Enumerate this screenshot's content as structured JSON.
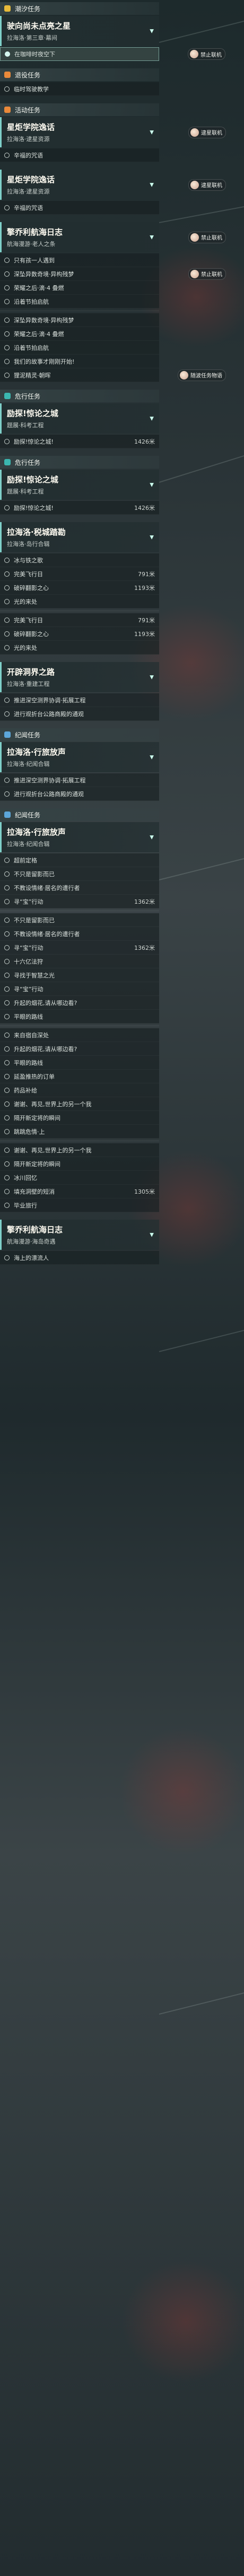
{
  "sections": [
    {
      "header": "潮汐任务",
      "headerIcon": "yellow",
      "card": {
        "title": "驶向尚未点亮之星",
        "subtitle": "拉海洛·第三章·幕间"
      },
      "rows": [
        {
          "label": "在咖啡时夜空下",
          "active": true,
          "tag": "禁止联机"
        }
      ]
    },
    {
      "header": "退役任务",
      "headerIcon": "orange",
      "rows": [
        {
          "label": "临时驾驶教学"
        }
      ]
    },
    {
      "header": "活动任务",
      "headerIcon": "orange",
      "card": {
        "title": "星炬学院逸话",
        "subtitle": "拉海洛·逮星资源",
        "tag": "逮星联机"
      },
      "rows": [
        {
          "label": "辛福的咒语"
        }
      ]
    },
    {
      "header": "",
      "card": {
        "title": "星炬学院逸话",
        "subtitle": "拉海洛·逮星资源",
        "tag": "逮星联机"
      },
      "rows": [
        {
          "label": "辛福的咒语"
        }
      ]
    },
    {
      "header": "",
      "card": {
        "title": "擎乔利航海日志",
        "subtitle": "航海漫游·老人之条",
        "tag": "禁止联机"
      },
      "rows": [
        {
          "label": "只有孩一人遇到"
        },
        {
          "label": "深坠异数奇境·异构残梦",
          "tag": "禁止联机"
        },
        {
          "label": "荣耀之后·滴·4 叠燃"
        },
        {
          "label": "沿着节拍启航"
        },
        {
          "label": ""
        },
        {
          "label": "深坠异数奇境·异构残梦"
        },
        {
          "label": "荣耀之后·滴·4 叠燃"
        },
        {
          "label": "沿着节拍启航"
        },
        {
          "label": "我们的故事才刚刚开始!"
        },
        {
          "label": "狸泥精灵·朝晖",
          "tag": "随波任务物语"
        }
      ]
    },
    {
      "header": "危行任务",
      "headerIcon": "teal",
      "card": {
        "title": "励探!惊论之城",
        "subtitle": "题展·科考工程"
      },
      "rows": [
        {
          "label": "励探!惊论之城!",
          "dist": "1426米"
        }
      ]
    },
    {
      "header": "危行任务",
      "headerIcon": "teal",
      "card": {
        "title": "励探!惊论之城",
        "subtitle": "题展·科考工程"
      },
      "rows": [
        {
          "label": "励探!惊论之城!",
          "dist": "1426米"
        }
      ]
    },
    {
      "header": "",
      "card": {
        "title": "拉海洛·税城踏勘",
        "subtitle": "拉海洛·岛行合辑"
      },
      "rows": [
        {
          "label": "冰与铁之歌"
        },
        {
          "label": "完美飞行日",
          "dist": "791米"
        },
        {
          "label": "破碎翻影之心",
          "dist": "1193米"
        },
        {
          "label": "光的来处"
        },
        {
          "label": ""
        },
        {
          "label": "完美飞行日",
          "dist": "791米"
        },
        {
          "label": "破碎翻影之心",
          "dist": "1193米"
        },
        {
          "label": "光的来处"
        }
      ]
    },
    {
      "header": "",
      "card": {
        "title": "开辟洞界之路",
        "subtitle": "拉海洛·重建工程"
      },
      "rows": [
        {
          "label": "推进深空测界协调·拓展工程"
        },
        {
          "label": "进行观折台公路商殿的通观"
        }
      ]
    },
    {
      "header": "纪闻任务",
      "headerIcon": "blue",
      "card": {
        "title": "拉海洛·行旅放声",
        "subtitle": "拉海洛·纪闻合辑"
      },
      "rows": [
        {
          "label": "推进深空测界协调·拓展工程"
        },
        {
          "label": "进行观折台公路商殿的通观"
        }
      ]
    },
    {
      "header": "纪闻任务",
      "headerIcon": "blue",
      "card": {
        "title": "拉海洛·行旅放声",
        "subtitle": "拉海洛·纪闻合辑"
      },
      "rows": [
        {
          "label": "超前定格"
        },
        {
          "label": "不只是留影而已"
        },
        {
          "label": "不教设情绪·居名的遭行者"
        },
        {
          "label": "寻“宝”行动",
          "dist": "1362米"
        },
        {
          "label": ""
        },
        {
          "label": "不只是留影而已"
        },
        {
          "label": "不教设情绪·居名的遭行者"
        },
        {
          "label": "寻“宝”行动",
          "dist": "1362米"
        },
        {
          "label": "十六亿法狩"
        },
        {
          "label": "寻找于智慧之光"
        },
        {
          "label": "寻“宝”行动"
        },
        {
          "label": "升起的烟花,请从哪边看?"
        },
        {
          "label": "平眼的路线"
        },
        {
          "label": ""
        },
        {
          "label": "来自宿自深处"
        },
        {
          "label": "升起的烟花,请从哪边看?"
        },
        {
          "label": "平眼的路线"
        },
        {
          "label": "延盈推热的订单"
        },
        {
          "label": "药品补给"
        },
        {
          "label": "谢谢、再见,世界上的另一个我"
        },
        {
          "label": "隔开新定将的瞬间"
        },
        {
          "label": "跳跳危情·上"
        },
        {
          "label": ""
        },
        {
          "label": "谢谢、再见,世界上的另一个我"
        },
        {
          "label": "隔开新定将的瞬间"
        },
        {
          "label": "冰川回忆"
        },
        {
          "label": "填充洞壁的短消",
          "dist": "1305米"
        },
        {
          "label": "毕业旅行"
        }
      ]
    },
    {
      "header": "",
      "card": {
        "title": "擎乔利航海日志",
        "subtitle": "航海漫游·海岛奇遇"
      },
      "rows": [
        {
          "label": "海上的漂流人"
        }
      ]
    }
  ]
}
